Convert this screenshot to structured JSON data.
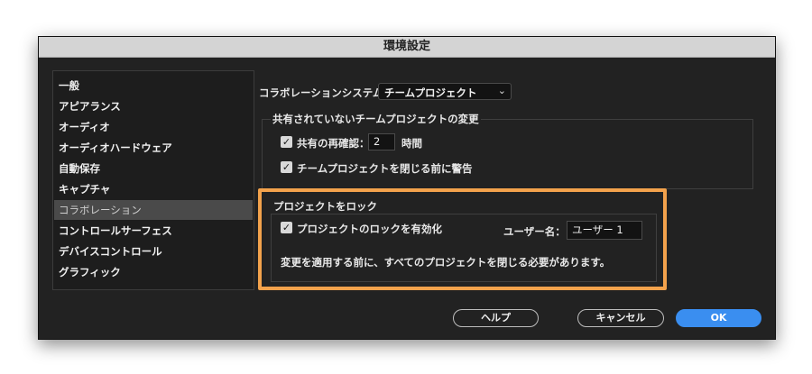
{
  "window": {
    "title": "環境設定"
  },
  "sidebar": {
    "items": [
      {
        "label": "一般"
      },
      {
        "label": "アピアランス"
      },
      {
        "label": "オーディオ"
      },
      {
        "label": "オーディオハードウェア"
      },
      {
        "label": "自動保存"
      },
      {
        "label": "キャプチャ"
      },
      {
        "label": "コラボレーション",
        "selected": true
      },
      {
        "label": "コントロールサーフェス"
      },
      {
        "label": "デバイスコントロール"
      },
      {
        "label": "グラフィック"
      }
    ]
  },
  "main": {
    "collab_system_label": "コラボレーションシステム：",
    "collab_system_value": "チームプロジェクト",
    "unshared": {
      "title": "共有されていないチームプロジェクトの変更",
      "reconfirm_label": "共有の再確認：",
      "reconfirm_value": "2",
      "reconfirm_unit": "時間",
      "warn_label": "チームプロジェクトを閉じる前に警告"
    },
    "lock": {
      "title": "プロジェクトをロック",
      "enable_label": "プロジェクトのロックを有効化",
      "username_label": "ユーザー名：",
      "username_value": "ユーザー 1",
      "note": "変更を適用する前に、すべてのプロジェクトを閉じる必要があります。"
    }
  },
  "buttons": {
    "help": "ヘルプ",
    "cancel": "キャンセル",
    "ok": "OK"
  },
  "colors": {
    "highlight": "#f3a24c",
    "accent": "#3a8ef0",
    "panel": "#222222"
  }
}
